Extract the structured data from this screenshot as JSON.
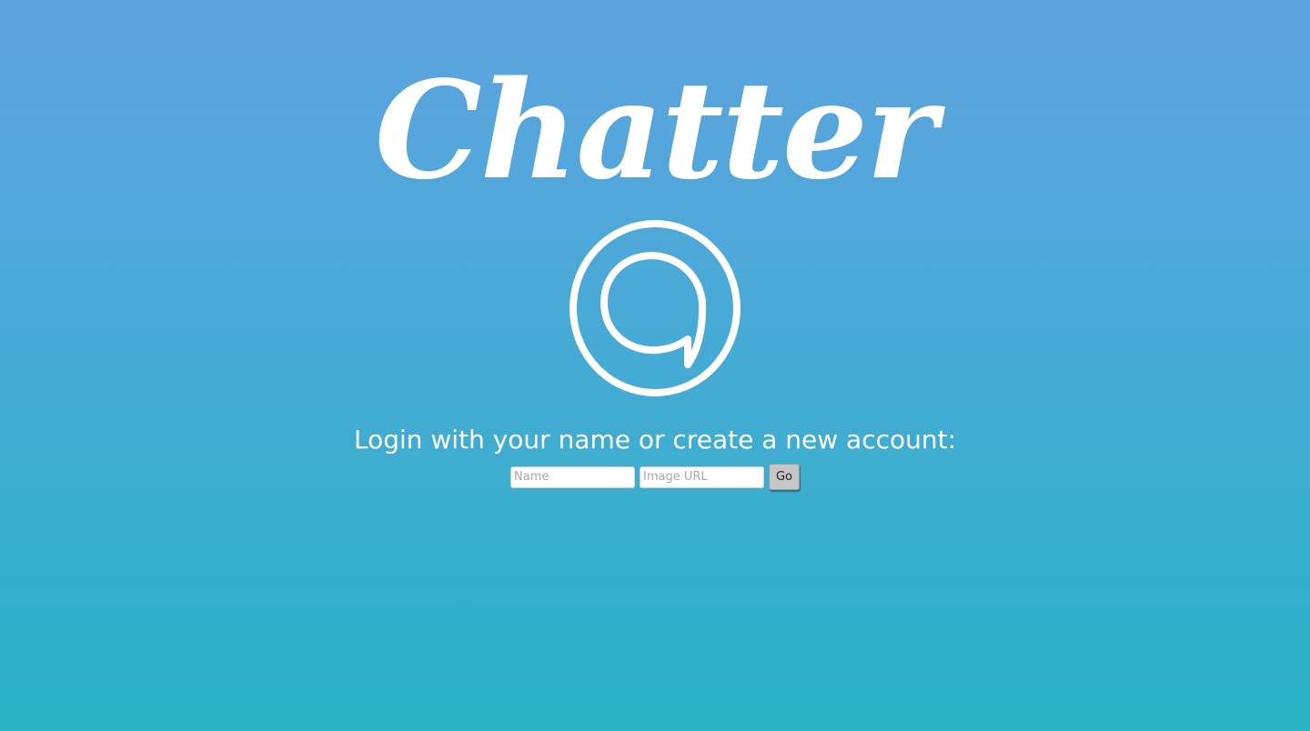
{
  "app": {
    "title": "Chatter"
  },
  "logo": {
    "icon": "chat-bubble-circle-icon",
    "color": "#ffffff"
  },
  "login": {
    "prompt": "Login with your name or create a new account:",
    "name_placeholder": "Name",
    "image_url_placeholder": "Image URL",
    "submit_label": "Go"
  },
  "colors": {
    "background_top": "#5fa3e0",
    "background_bottom": "#2ab4c5",
    "text": "#ffffff",
    "button": "#c6c6c6"
  }
}
